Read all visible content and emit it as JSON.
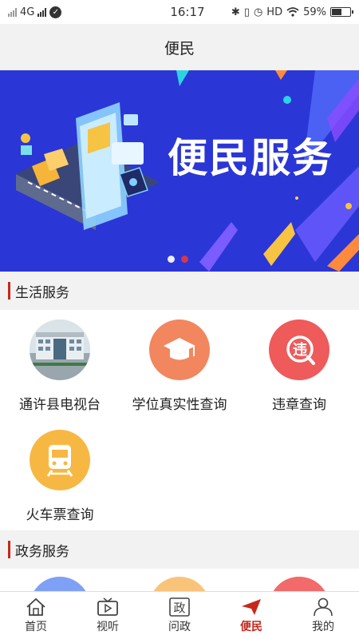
{
  "status": {
    "network": "4G",
    "time": "16:17",
    "hd": "HD",
    "battery": "59%",
    "battery_level": 0.59
  },
  "header": {
    "title": "便民"
  },
  "banner": {
    "text": "便民服务",
    "slide_count": 2,
    "active_slide": 2
  },
  "sections": [
    {
      "title": "生活服务",
      "items": [
        {
          "label": "通许县电视台",
          "icon": "tv-station-photo"
        },
        {
          "label": "学位真实性查询",
          "icon": "graduation-cap-icon",
          "color": "#f2865e"
        },
        {
          "label": "违章查询",
          "icon": "violation-search-icon",
          "color": "#ef5a5a"
        },
        {
          "label": "火车票查询",
          "icon": "train-icon",
          "color": "#f7b843"
        }
      ]
    },
    {
      "title": "政务服务",
      "items": [
        {
          "icon": "service-icon",
          "color": "#7fa1f5"
        },
        {
          "icon": "service-icon",
          "color": "#f9c47a"
        },
        {
          "icon": "service-icon",
          "color": "#f26a6a"
        }
      ]
    }
  ],
  "nav": [
    {
      "label": "首页",
      "icon": "home-icon"
    },
    {
      "label": "视听",
      "icon": "tv-icon"
    },
    {
      "label": "问政",
      "icon": "zheng-icon",
      "glyph": "政"
    },
    {
      "label": "便民",
      "icon": "paper-plane-icon",
      "active": true
    },
    {
      "label": "我的",
      "icon": "user-icon"
    }
  ],
  "colors": {
    "accent": "#c6281d",
    "banner_bg": "#2b36d6"
  }
}
